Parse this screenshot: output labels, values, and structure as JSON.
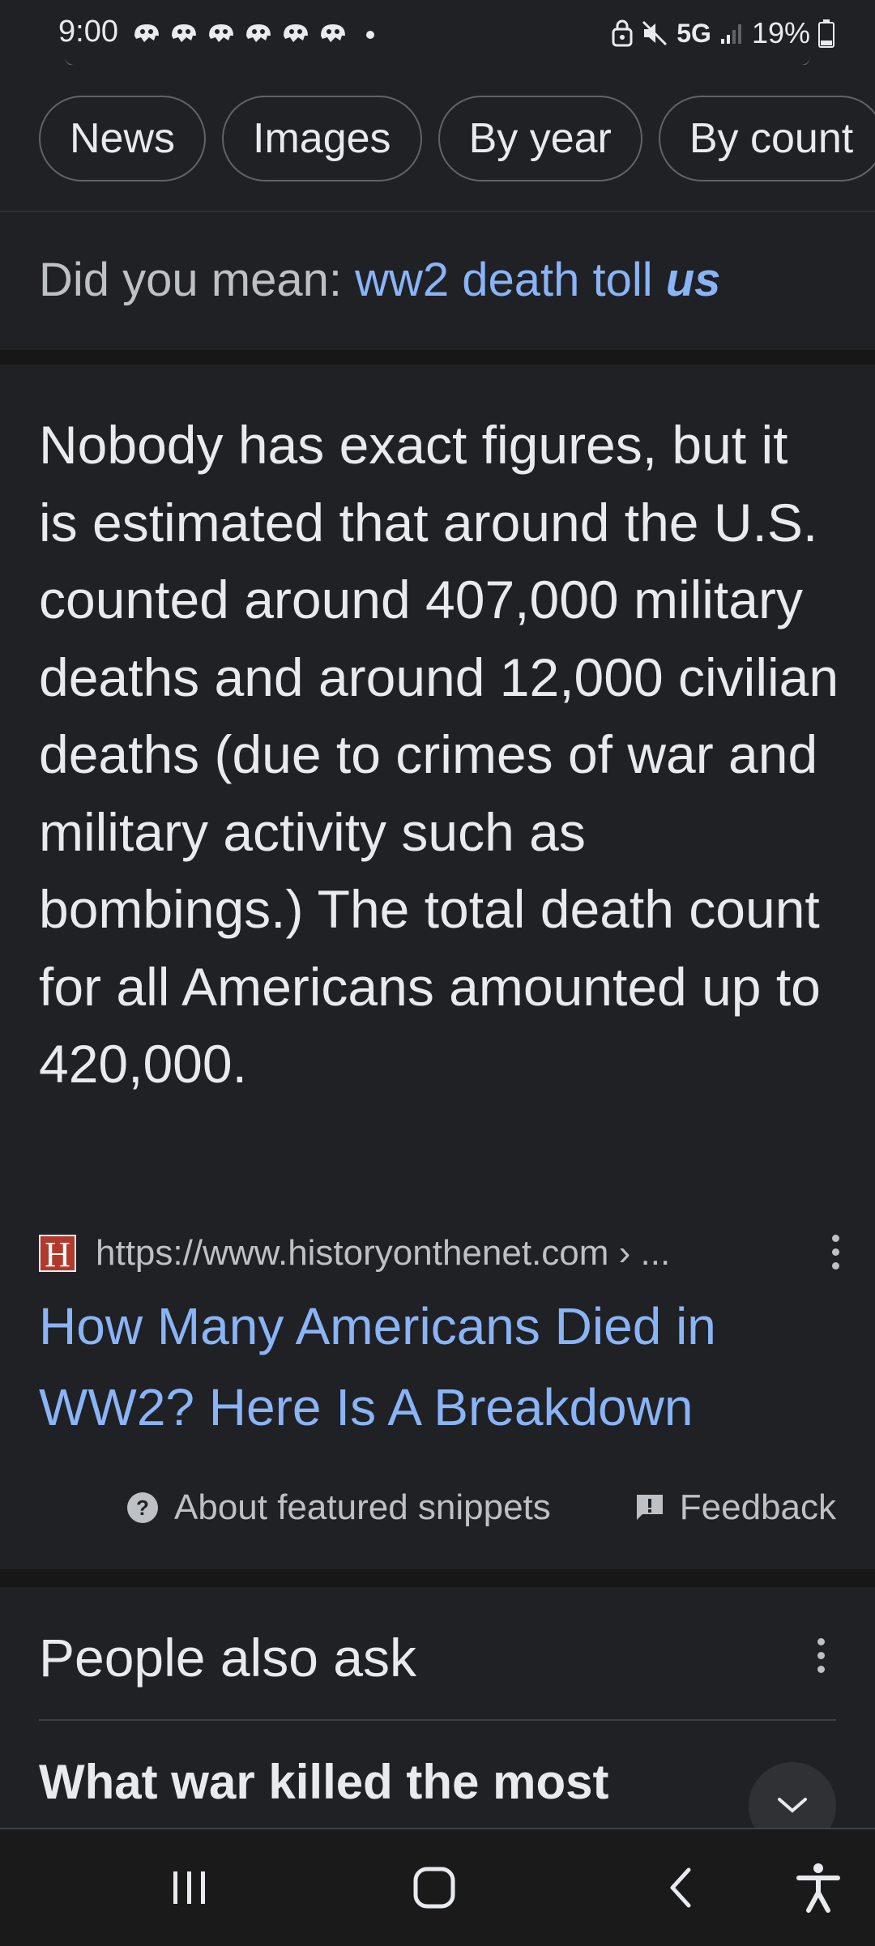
{
  "status_bar": {
    "time": "9:00",
    "notification_icons": [
      "app-notification-icon",
      "app-notification-icon",
      "app-notification-icon",
      "app-notification-icon",
      "app-notification-icon",
      "app-notification-icon"
    ],
    "network": "5G",
    "battery": "19%"
  },
  "chips": [
    "News",
    "Images",
    "By year",
    "By count"
  ],
  "did_you_mean": {
    "prefix": "Did you mean: ",
    "suggestion_plain": "ww2 death toll ",
    "suggestion_bold": "us"
  },
  "snippet": {
    "text": "Nobody has exact figures, but it is estimated that around the U.S. counted around 407,000 military deaths and around 12,000 civilian deaths (due to crimes of war and military activity such as bombings.) The total death count for all Americans amounted up to 420,000.",
    "favicon_letter": "H",
    "source_url": "https://www.historyonthenet.com › ...",
    "title": "How Many Americans Died in WW2? Here Is A Breakdown",
    "about_label": "About featured snippets",
    "feedback_label": "Feedback"
  },
  "people_also_ask": {
    "title": "People also ask",
    "question": "What war killed the most Americans?"
  },
  "colors": {
    "background": "#202124",
    "link": "#8ab4f8",
    "text": "#e8eaed",
    "muted": "#bdc1c6",
    "favicon": "#b23a2d"
  }
}
